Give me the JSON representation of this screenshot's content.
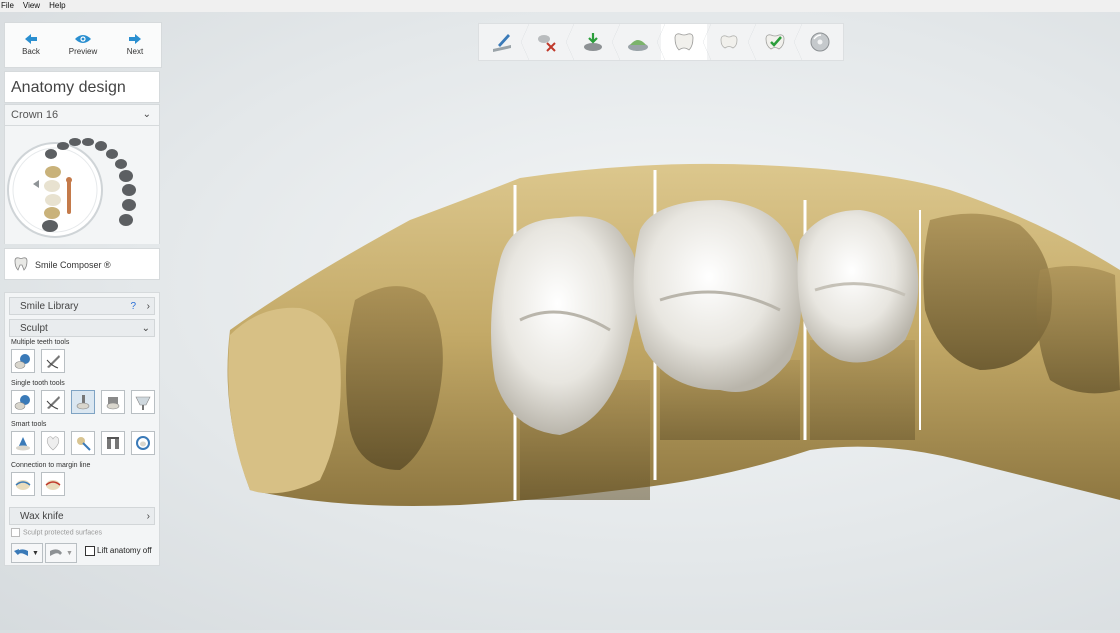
{
  "menu": [
    "File",
    "View",
    "Help"
  ],
  "nav": {
    "back": "Back",
    "preview": "Preview",
    "next": "Next"
  },
  "panel_title": "Anatomy design",
  "crown": {
    "label": "Crown 16"
  },
  "smile_composer": "Smile Composer ®",
  "sections": {
    "smile_library": "Smile Library",
    "smile_library_help": "?",
    "sculpt": "Sculpt",
    "wax_knife": "Wax knife"
  },
  "sub_labels": {
    "multiple": "Multiple teeth tools",
    "single": "Single tooth tools",
    "smart": "Smart tools",
    "connection": "Connection to margin line"
  },
  "checkboxes": {
    "sculpt_protected": "Sculpt protected surfaces",
    "lift_anatomy": "Lift anatomy off"
  },
  "workflow_steps": [
    "scan-edit-icon",
    "cut-icon",
    "model-import-icon",
    "margin-icon",
    "crown-icon",
    "tooth-icon",
    "check-icon",
    "disc-icon"
  ],
  "active_step": 4,
  "colors": {
    "accent": "#2a8fd0",
    "model": "#c9b27a",
    "crown": "#e8e6e1"
  }
}
